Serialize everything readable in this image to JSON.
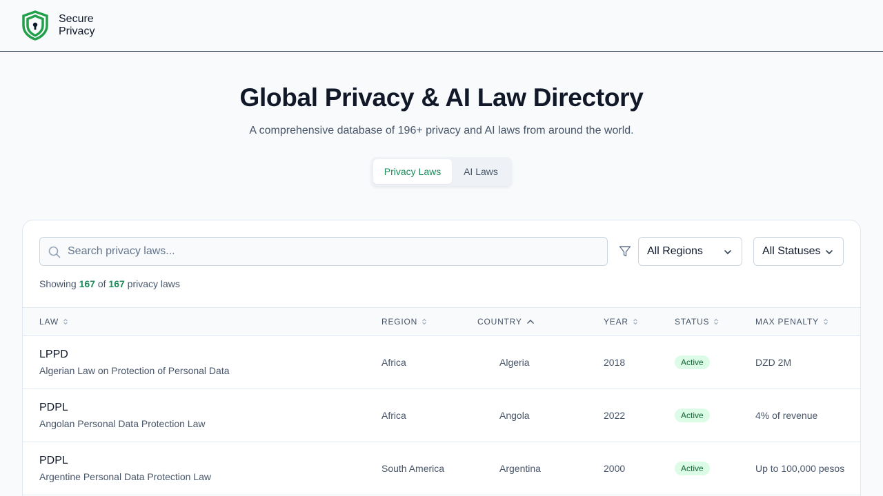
{
  "brand": {
    "line1": "Secure",
    "line2": "Privacy",
    "color": "#22a04b"
  },
  "hero": {
    "title": "Global Privacy & AI Law Directory",
    "subtitle": "A comprehensive database of 196+ privacy and AI laws from around the world."
  },
  "tabs": [
    {
      "label": "Privacy Laws",
      "active": true
    },
    {
      "label": "AI Laws",
      "active": false
    }
  ],
  "search": {
    "placeholder": "Search privacy laws..."
  },
  "filters": {
    "region": "All Regions",
    "status": "All Statuses"
  },
  "summary": {
    "prefix": "Showing",
    "shown": "167",
    "of": "of",
    "total": "167",
    "suffix": "privacy laws"
  },
  "table": {
    "headers": [
      "LAW",
      "REGION",
      "COUNTRY",
      "YEAR",
      "STATUS",
      "MAX PENALTY"
    ],
    "sorted_column": "COUNTRY",
    "rows": [
      {
        "abbr": "LPPD",
        "name": "Algerian Law on Protection of Personal Data",
        "region": "Africa",
        "country": "Algeria",
        "year": "2018",
        "status": "Active",
        "penalty": "DZD 2M"
      },
      {
        "abbr": "PDPL",
        "name": "Angolan Personal Data Protection Law",
        "region": "Africa",
        "country": "Angola",
        "year": "2022",
        "status": "Active",
        "penalty": "4% of revenue"
      },
      {
        "abbr": "PDPL",
        "name": "Argentine Personal Data Protection Law",
        "region": "South America",
        "country": "Argentina",
        "year": "2000",
        "status": "Active",
        "penalty": "Up to 100,000 pesos"
      }
    ]
  },
  "colors": {
    "accent": "#1f8a5a",
    "badge_bg": "#dcfce7",
    "badge_text": "#166534"
  }
}
